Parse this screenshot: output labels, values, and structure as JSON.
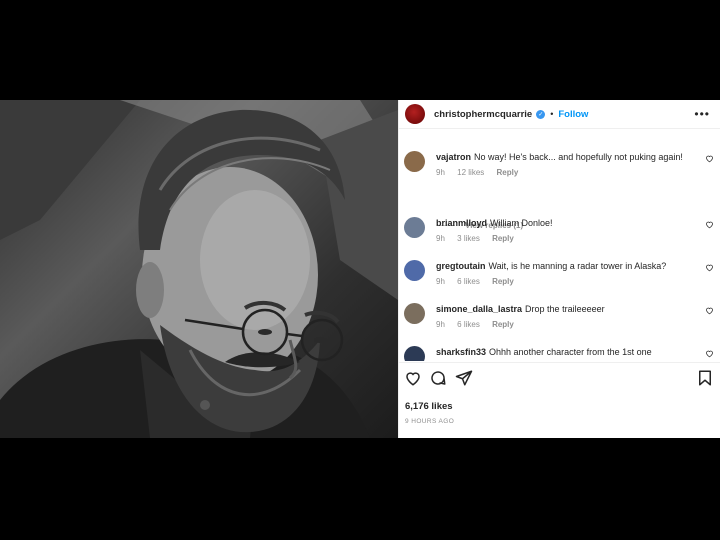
{
  "header": {
    "username": "christophermcquarrie",
    "separator": "•",
    "follow_label": "Follow",
    "more_label": "•••"
  },
  "comments": [
    {
      "user": "vajatron",
      "text": "No way! He's back... and hopefully not puking again!",
      "age": "9h",
      "likes": "12 likes",
      "reply": "Reply",
      "avatar_color": "#8a6a4a"
    },
    {
      "user": "brianmlloyd",
      "text": "William Donloe!",
      "age": "9h",
      "likes": "3 likes",
      "reply": "Reply",
      "avatar_color": "#6c7c95"
    },
    {
      "user": "gregtoutain",
      "text": "Wait, is he manning a radar tower in Alaska?",
      "age": "9h",
      "likes": "6 likes",
      "reply": "Reply",
      "avatar_color": "#4f6aa8"
    },
    {
      "user": "simone_dalla_lastra",
      "text": "Drop the traileeeeer",
      "age": "9h",
      "likes": "6 likes",
      "reply": "Reply",
      "avatar_color": "#7b6e5e"
    },
    {
      "user": "sharksfin33",
      "text": "Ohhh another character from the 1st one",
      "age": "",
      "likes": "",
      "reply": "",
      "avatar_color": "#2c3a55"
    }
  ],
  "view_replies": "View replies (1)",
  "footer": {
    "likes": "6,176 likes",
    "time": "9 HOURS AGO"
  },
  "icons": {
    "like": "heart-icon",
    "comment": "comment-bubble-icon",
    "share": "paper-plane-icon",
    "save": "bookmark-icon"
  }
}
